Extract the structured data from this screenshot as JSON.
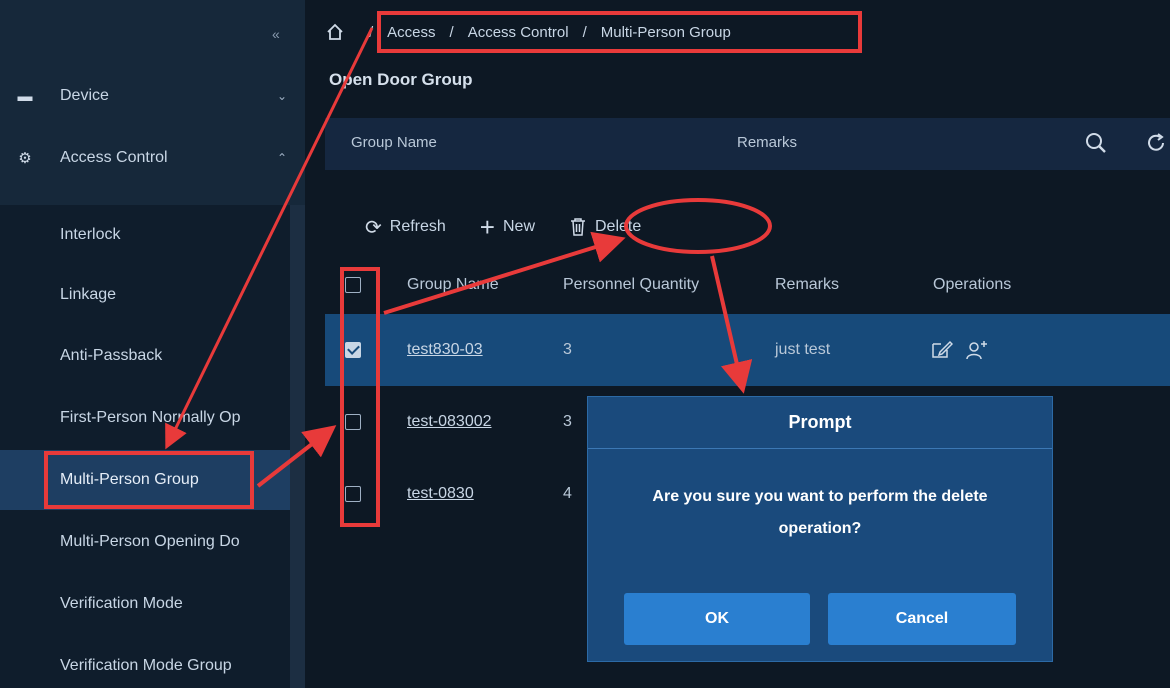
{
  "sidebar": {
    "collapse_icon": "double-chevron-left-icon",
    "top_items": [
      {
        "label": "Device",
        "icon": "device-icon",
        "arrow": "chevron-down-icon"
      },
      {
        "label": "Access Control",
        "icon": "gear-icon",
        "arrow": "chevron-up-icon"
      }
    ],
    "sub_items": [
      {
        "label": "Interlock"
      },
      {
        "label": "Linkage"
      },
      {
        "label": "Anti-Passback"
      },
      {
        "label": "First-Person Normally Op"
      },
      {
        "label": "Multi-Person Group"
      },
      {
        "label": "Multi-Person Opening Do"
      },
      {
        "label": "Verification Mode"
      },
      {
        "label": "Verification Mode Group"
      }
    ]
  },
  "breadcrumb": {
    "home_icon": "home-icon",
    "items": [
      "Access",
      "Access Control",
      "Multi-Person Group"
    ]
  },
  "page_title": "Open Door Group",
  "filter": {
    "group_name_label": "Group Name",
    "remarks_label": "Remarks"
  },
  "toolbar": {
    "refresh": "Refresh",
    "new": "New",
    "delete": "Delete"
  },
  "table": {
    "headers": [
      "Group Name",
      "Personnel Quantity",
      "Remarks",
      "Operations"
    ],
    "rows": [
      {
        "group_name": "test830-03",
        "quantity": "3",
        "remarks": "just test",
        "checked": true
      },
      {
        "group_name": "test-083002",
        "quantity": "3",
        "remarks": "",
        "checked": false
      },
      {
        "group_name": "test-0830",
        "quantity": "4",
        "remarks": "",
        "checked": false
      }
    ]
  },
  "modal": {
    "title": "Prompt",
    "message": "Are you sure you want to perform the delete operation?",
    "ok": "OK",
    "cancel": "Cancel"
  },
  "colors": {
    "sidebar_bg": "#16283a",
    "main_bg": "#0d1824",
    "selected_row": "#174a7a",
    "modal_bg": "#1a4a7c",
    "primary_button": "#2a7fd0",
    "annotation_red": "#e83a3a"
  }
}
